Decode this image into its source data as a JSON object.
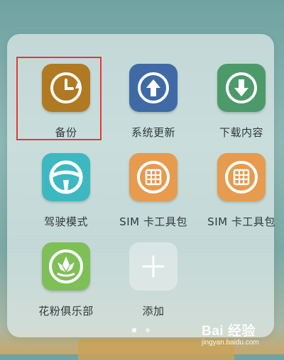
{
  "apps": [
    {
      "label": "备份",
      "icon": "backup-clock-icon",
      "color": "#b07a22"
    },
    {
      "label": "系统更新",
      "icon": "arrow-up-circle-icon",
      "color": "#3f6aa6"
    },
    {
      "label": "下载内容",
      "icon": "arrow-down-circle-icon",
      "color": "#4c9a6a"
    },
    {
      "label": "驾驶模式",
      "icon": "steering-wheel-icon",
      "color": "#3db8c1"
    },
    {
      "label": "SIM 卡工具包",
      "icon": "sim-card-icon",
      "color": "#e69b4f"
    },
    {
      "label": "SIM 卡工具包",
      "icon": "sim-card-icon",
      "color": "#e69b4f"
    },
    {
      "label": "花粉俱乐部",
      "icon": "lotus-icon",
      "color": "#7fbf58"
    },
    {
      "label": "添加",
      "icon": "plus-icon",
      "color": "#dfe7e6"
    }
  ],
  "page_indicator": {
    "pages": 2,
    "current": 1
  },
  "watermark": {
    "brand": "Bai 经验",
    "url": "jingyan.baidu.com"
  },
  "colors": {
    "highlight": "#e53935",
    "folder_bg": "rgba(225,236,234,0.72)"
  }
}
